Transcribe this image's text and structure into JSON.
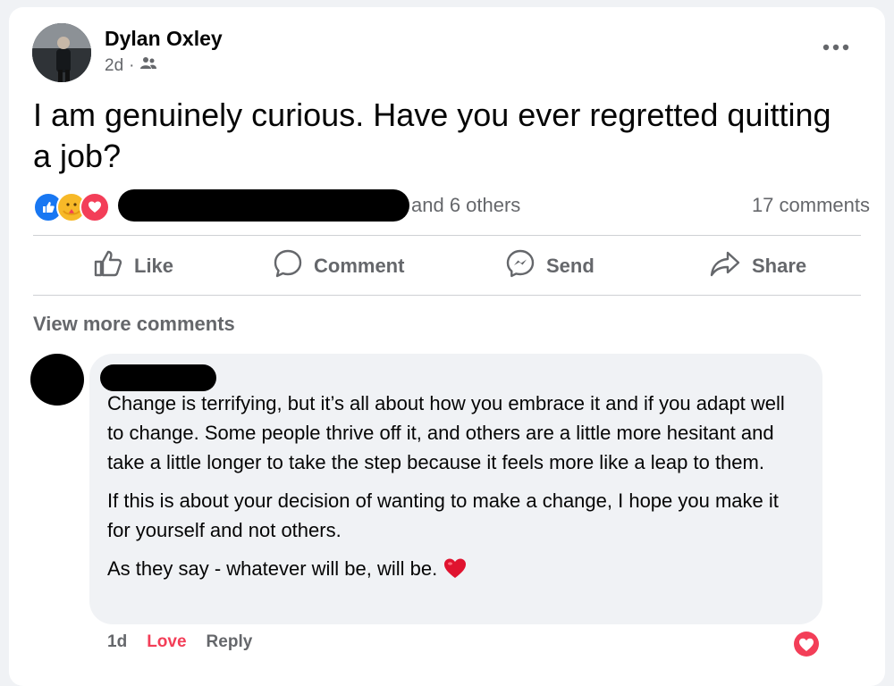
{
  "post": {
    "author": "Dylan Oxley",
    "time": "2d",
    "audience_icon": "friends-icon",
    "text": "I am genuinely curious. Have you ever regretted quitting a job?",
    "reaction_icons": [
      "like-icon",
      "care-icon",
      "love-icon"
    ],
    "and_others": "and 6 others",
    "comments_count": "17 comments"
  },
  "actions": {
    "like": "Like",
    "comment": "Comment",
    "send": "Send",
    "share": "Share"
  },
  "view_more": "View more comments",
  "comment": {
    "paragraphs": [
      "Change is terrifying, but it’s all about how you embrace it and if you adapt well to change. Some people thrive off it, and others are a little more hesitant and take a little longer to take the step because it feels more like a leap to them.",
      "If this is about your decision of wanting to make a change, I hope you make it for yourself and not others.",
      "As they say - whatever will be, will be."
    ],
    "time": "1d",
    "love_label": "Love",
    "reply_label": "Reply",
    "colors": {
      "love": "#f33e58",
      "meta": "#65676b",
      "bubble": "#f0f2f5"
    }
  }
}
